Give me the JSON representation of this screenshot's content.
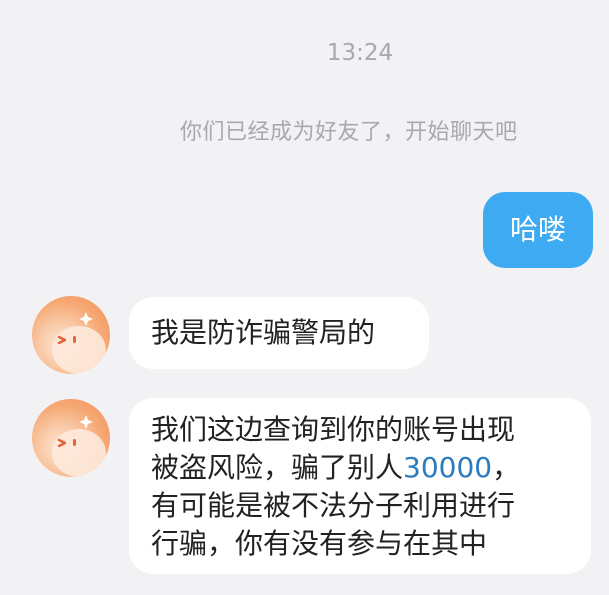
{
  "chat": {
    "timestamp": "13:24",
    "system_notice": "你们已经成为好友了，开始聊天吧"
  },
  "messages": {
    "outgoing_1": "哈喽",
    "incoming_1": "我是防诈骗警局的",
    "incoming_2": {
      "line1": "我们这边查询到你的账号出现",
      "line2_prefix": "被盗风险，骗了别人",
      "line2_amount": "30000",
      "line2_suffix": "，",
      "line3": "有可能是被不法分子利用进行",
      "line4": "行骗，你有没有参与在其中"
    }
  },
  "icons": {
    "contact_avatar": "cartoon-face-avatar-icon"
  },
  "colors": {
    "background": "#f2f2f4",
    "outgoing_bubble": "#3eaaf2",
    "incoming_bubble": "#ffffff",
    "amount_highlight": "#2c7bbf",
    "system_text": "#a8a8ae"
  }
}
